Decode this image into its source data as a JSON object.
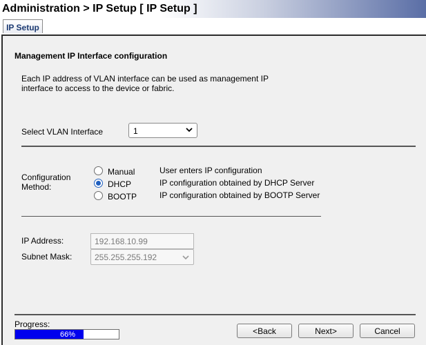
{
  "header": {
    "title": "Administration > IP Setup [ IP Setup ]"
  },
  "tabs": [
    {
      "label": "IP Setup",
      "active": true
    }
  ],
  "section": {
    "title": "Management IP Interface configuration",
    "description_line1": "Each IP address of VLAN interface can be used as management IP",
    "description_line2": "interface to access to the device or fabric."
  },
  "vlan": {
    "label": "Select VLAN Interface",
    "value": "1"
  },
  "config_method": {
    "label_line1": "Configuration",
    "label_line2": "Method:",
    "selected": "DHCP",
    "options": [
      {
        "label": "Manual",
        "description": "User enters IP configuration",
        "checked": false
      },
      {
        "label": "DHCP",
        "description": "IP configuration obtained by DHCP Server",
        "checked": true
      },
      {
        "label": "BOOTP",
        "description": "IP configuration obtained by BOOTP Server",
        "checked": false
      }
    ]
  },
  "ip": {
    "address_label": "IP Address:",
    "address_value": "192.168.10.99",
    "mask_label": "Subnet Mask:",
    "mask_value": "255.255.255.192"
  },
  "progress": {
    "label": "Progress:",
    "percent_text": "66%",
    "value": 0.66,
    "bar_color": "#0000ee"
  },
  "buttons": {
    "back": "<Back",
    "next": "Next>",
    "cancel": "Cancel"
  },
  "colors": {
    "accent": "#1f5fbf",
    "header_gradient_end": "#5a6ea6",
    "panel_bg": "#f0f0f0"
  },
  "icons": {
    "dropdown": "chevron-down-icon",
    "radio_checked": "radio-checked-icon",
    "radio_unchecked": "radio-unchecked-icon"
  }
}
